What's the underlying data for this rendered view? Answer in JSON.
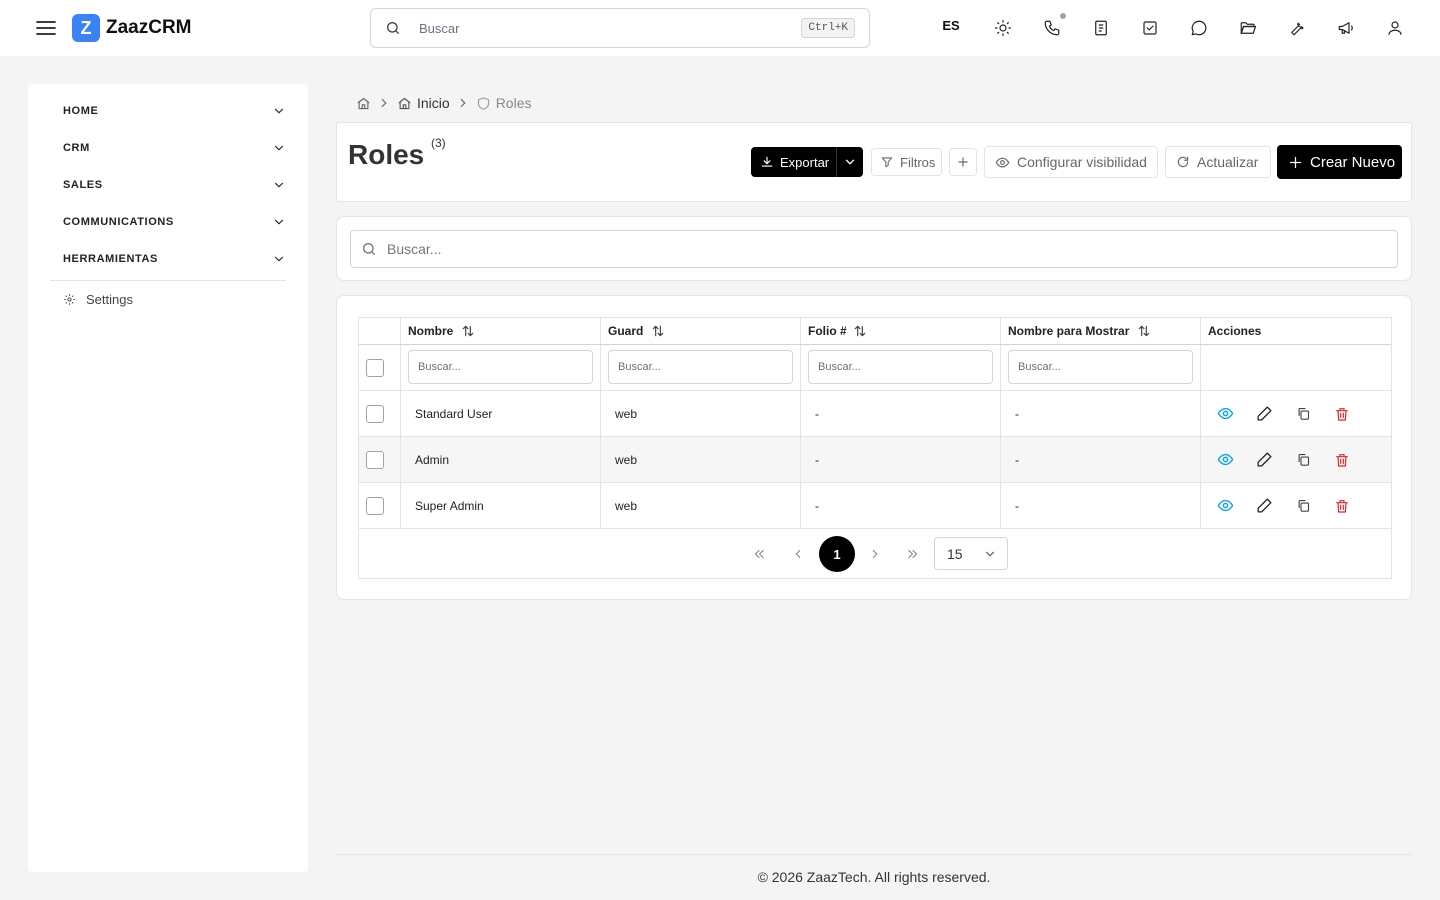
{
  "app": {
    "logo_letter": "Z",
    "name": "ZaazCRM"
  },
  "header": {
    "search_placeholder": "Buscar",
    "shortcut": "Ctrl+K",
    "language": "ES",
    "icons": [
      "sun-icon",
      "phone-icon",
      "notes-icon",
      "tasks-icon",
      "chat-icon",
      "folder-icon",
      "wrench-icon",
      "megaphone-icon",
      "user-icon"
    ]
  },
  "sidebar": {
    "items": [
      {
        "label": "HOME"
      },
      {
        "label": "CRM"
      },
      {
        "label": "SALES"
      },
      {
        "label": "COMMUNICATIONS"
      },
      {
        "label": "HERRAMIENTAS"
      }
    ],
    "settings_label": "Settings"
  },
  "breadcrumb": {
    "home": "Inicio",
    "current": "Roles"
  },
  "page": {
    "title": "Roles",
    "count": "(3)",
    "buttons": {
      "export": "Exportar",
      "filters": "Filtros",
      "visibility": "Configurar visibilidad",
      "refresh": "Actualizar",
      "create": "Crear Nuevo"
    },
    "search_placeholder": "Buscar..."
  },
  "table": {
    "columns": [
      "Nombre",
      "Guard",
      "Folio #",
      "Nombre para Mostrar",
      "Acciones"
    ],
    "filter_placeholder": "Buscar...",
    "rows": [
      {
        "nombre": "Standard User",
        "guard": "web",
        "folio": "-",
        "display": "-"
      },
      {
        "nombre": "Admin",
        "guard": "web",
        "folio": "-",
        "display": "-"
      },
      {
        "nombre": "Super Admin",
        "guard": "web",
        "folio": "-",
        "display": "-"
      }
    ],
    "action_colors": {
      "view": "#0ea5e9",
      "edit": "#222222",
      "copy": "#444444",
      "delete": "#dc2626"
    }
  },
  "pagination": {
    "current_page": "1",
    "per_page": "15"
  },
  "footer": {
    "text": "© 2026 ZaazTech. All rights reserved."
  }
}
